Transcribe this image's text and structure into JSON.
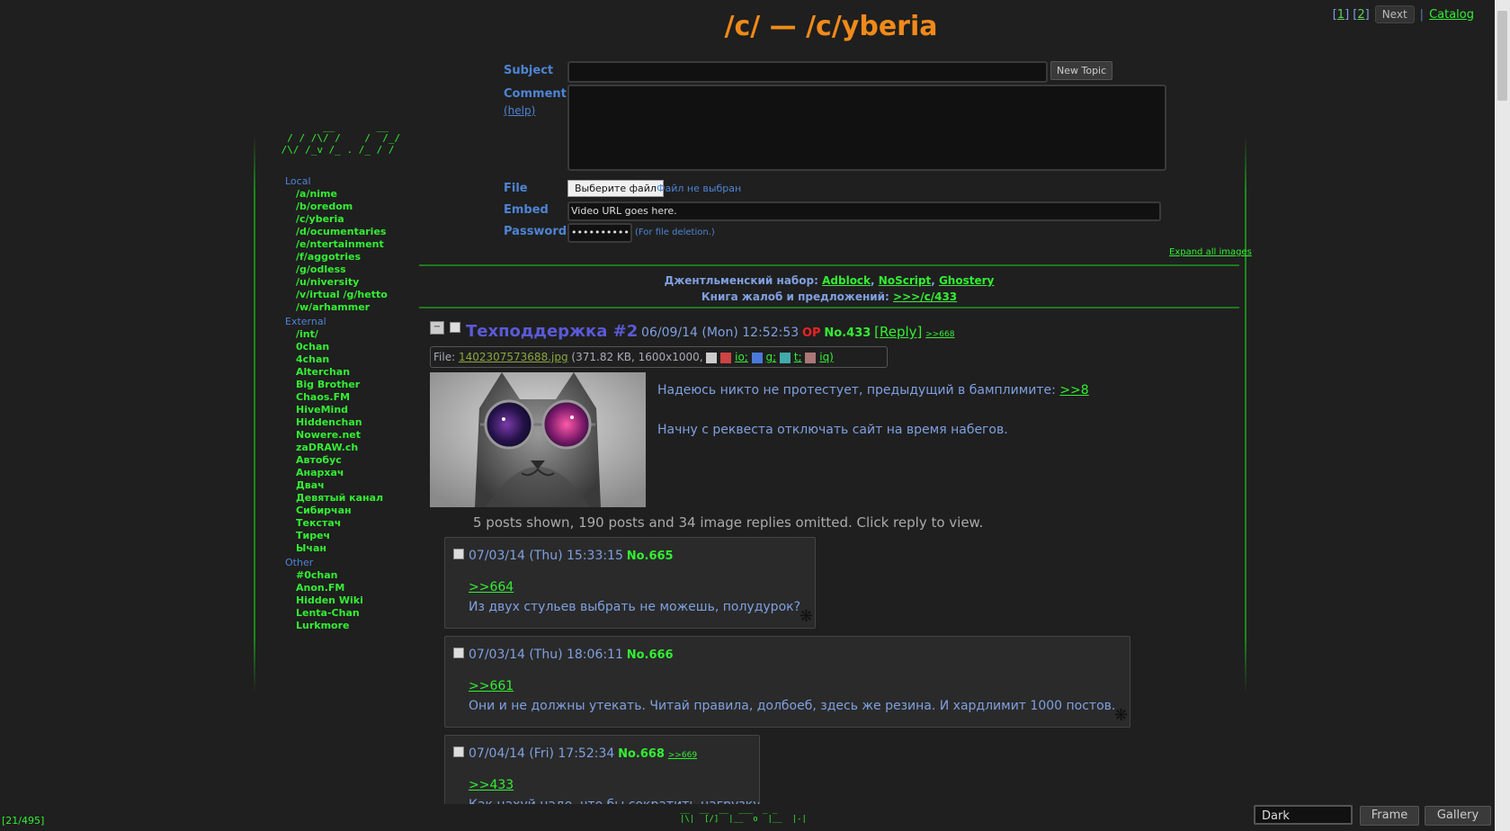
{
  "topnav": {
    "pages": [
      "1",
      "2"
    ],
    "next": "Next",
    "catalog": "Catalog"
  },
  "title": "/c/ — /c/yberia",
  "form": {
    "subject_label": "Subject",
    "new_topic": "New Topic",
    "comment_label": "Comment",
    "help": "(help)",
    "file_label": "File",
    "file_button": "Выберите файл",
    "file_status": "Файл не выбран",
    "embed_label": "Embed",
    "embed_placeholder": "Video URL goes here.",
    "password_label": "Password",
    "password_value": "••••••••••",
    "password_note": "(For file deletion.)",
    "expand_all": "Expand all images"
  },
  "logo": "        __       __\n  / / /\\/ /    /  /_/\n /\\/ /_v /_ . /_ / /",
  "sidebar": {
    "local_head": "Local",
    "local": [
      "/a/nime",
      "/b/oredom",
      "/c/yberia",
      "/d/ocumentaries",
      "/e/ntertainment",
      "/f/aggotries",
      "/g/odless",
      "/u/niversity",
      "/v/irtual /g/hetto",
      "/w/arhammer"
    ],
    "external_head": "External",
    "external": [
      "/int/",
      "0chan",
      "4chan",
      "Alterchan",
      "Big Brother",
      "Chaos.FM",
      "HiveMind",
      "Hiddenchan",
      "Nowere.net",
      "zaDRAW.ch",
      "Автобус",
      "Анархач",
      "Двач",
      "Девятый канал",
      "Сибирчан",
      "Текстач",
      "Тиреч",
      "Ычан"
    ],
    "other_head": "Other",
    "other": [
      "#0chan",
      "Anon.FM",
      "Hidden Wiki",
      "Lenta-Chan",
      "Lurkmore"
    ]
  },
  "announce": {
    "line1_prefix": "Джентльменский набор:",
    "links1": [
      "Adblock",
      "NoScript",
      "Ghostery"
    ],
    "line2_prefix": "Книга жалоб и предложений:",
    "link2": ">>>/c/433"
  },
  "op": {
    "subject": "Техподдержка #2",
    "date": "06/09/14 (Mon) 12:52:53",
    "op_label": "OP",
    "number": "No.433",
    "reply": "[Reply]",
    "backlink": ">>668",
    "file_prefix": "File:",
    "file_name": "1402307573688.jpg",
    "file_info": "(371.82 KB, 1600x1000,",
    "search_links": [
      "io;",
      "g;",
      "t;",
      "iq)"
    ],
    "text1": "Надеюсь никто не протестует, предыдущий в бамплимите:",
    "text1_link": ">>8",
    "text2": "Начну с реквеста отключать сайт на время набегов.",
    "omitted": "5 posts shown, 190 posts and 34 image replies omitted. Click reply to view."
  },
  "replies": [
    {
      "date": "07/03/14 (Thu) 15:33:15",
      "number": "No.665",
      "quote": ">>664",
      "text": "Из двух стульев выбрать не можешь, полудурок?"
    },
    {
      "date": "07/03/14 (Thu) 18:06:11",
      "number": "No.666",
      "quote": ">>661",
      "text": "Они и не должны утекать. Читай правила, долбоеб, здесь же резина. И хардлимит 1000 постов."
    },
    {
      "date": "07/04/14 (Fri) 17:52:34",
      "number": "No.668",
      "backlink": ">>669",
      "quote": ">>433",
      "text": "Как нахуй надо, что бы сократить нагрузку?"
    }
  ],
  "footer": {
    "counter": "[21/495]",
    "logo": "__  __  __  ___  _ _\n|\\|  [/]  |__  o  |__  |-|",
    "style_value": "Dark",
    "frame": "Frame",
    "gallery": "Gallery"
  },
  "colors": {
    "accent": "#f08a1a",
    "link": "#33ee33",
    "label": "#4e84d4",
    "bg": "#1f1f1f",
    "op": "#ee2222",
    "subject": "#5a5ad8"
  }
}
